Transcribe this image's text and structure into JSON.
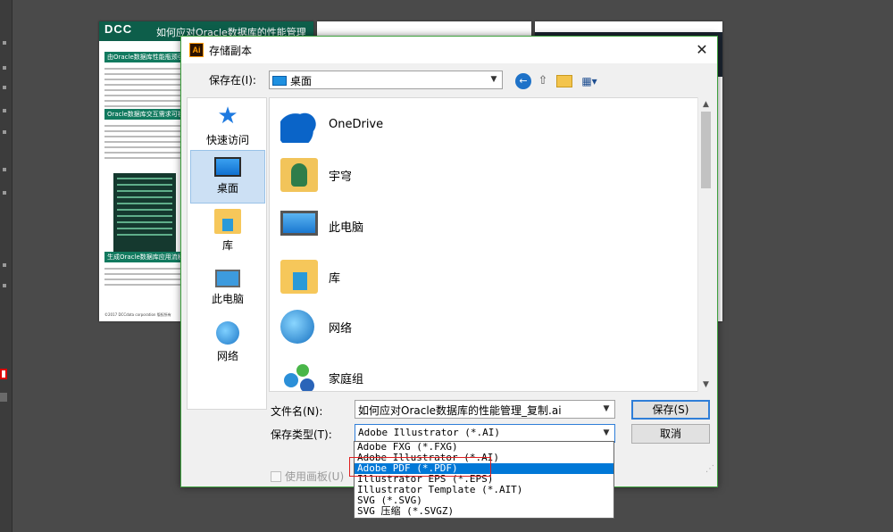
{
  "dialog": {
    "title": "存储副本",
    "app_icon_text": "Ai",
    "close_symbol": "✕",
    "save_in_label": "保存在(I):",
    "save_in_value": "桌面",
    "filename_label": "文件名(N):",
    "filename_value": "如何应对Oracle数据库的性能管理_复制.ai",
    "filetype_label": "保存类型(T):",
    "filetype_value": "Adobe Illustrator (*.AI)",
    "save_button": "保存(S)",
    "cancel_button": "取消",
    "use_artboards_label": "使用画板(U)"
  },
  "places": [
    {
      "label": "快速访问",
      "icon": "quick-access-star-icon"
    },
    {
      "label": "桌面",
      "icon": "desktop-icon",
      "selected": true
    },
    {
      "label": "库",
      "icon": "library-icon"
    },
    {
      "label": "此电脑",
      "icon": "this-pc-icon"
    },
    {
      "label": "网络",
      "icon": "network-icon"
    }
  ],
  "files": [
    {
      "name": "OneDrive",
      "icon": "onedrive-cloud-icon"
    },
    {
      "name": "宇穹",
      "icon": "user-folder-icon"
    },
    {
      "name": "此电脑",
      "icon": "this-pc-icon"
    },
    {
      "name": "库",
      "icon": "library-icon"
    },
    {
      "name": "网络",
      "icon": "network-icon"
    },
    {
      "name": "家庭组",
      "icon": "homegroup-icon"
    }
  ],
  "filetype_options": [
    "Adobe FXG (*.FXG)",
    "Adobe Illustrator (*.AI)",
    "Adobe PDF (*.PDF)",
    "Illustrator EPS (*.EPS)",
    "Illustrator Template (*.AIT)",
    "SVG (*.SVG)",
    "SVG 压缩 (*.SVGZ)"
  ],
  "highlighted_option": "Adobe PDF (*.PDF)",
  "document": {
    "logo": "DCC",
    "title": "如何应对Oracle数据库的性能管理",
    "section1": "由Oracle数据库性能瓶颈引发的",
    "section2": "Oracle数据库交互需求可视化",
    "section3": "生成Oracle数据库应用流程",
    "footer": "©2017 DCCdata corporation 版权所有"
  },
  "colors": {
    "accent_blue": "#0078d7",
    "dialog_border": "#3fa23f",
    "doc_green": "#0d5e4a",
    "highlight_box": "#e02020"
  }
}
